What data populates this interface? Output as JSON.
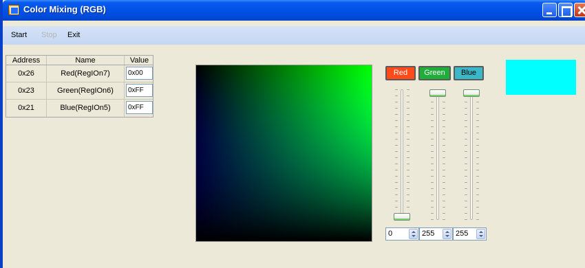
{
  "window": {
    "title": "Color Mixing (RGB)"
  },
  "menu": {
    "items": [
      {
        "label": "Start",
        "enabled": true
      },
      {
        "label": "Stop",
        "enabled": false
      },
      {
        "label": "Exit",
        "enabled": true
      }
    ]
  },
  "table": {
    "headers": [
      "Address",
      "Name",
      "Value"
    ],
    "rows": [
      {
        "address": "0x26",
        "name": "Red(RegIOn7)",
        "value": "0x00"
      },
      {
        "address": "0x23",
        "name": "Green(RegIOn6)",
        "value": "0xFF"
      },
      {
        "address": "0x21",
        "name": "Blue(RegIOn5)",
        "value": "0xFF"
      }
    ]
  },
  "channels": {
    "red": {
      "label": "Red",
      "color": "#ff4a1a",
      "text_color": "#ffffff",
      "value": "0",
      "level": 0
    },
    "green": {
      "label": "Green",
      "color": "#1fae3a",
      "text_color": "#ffffff",
      "value": "255",
      "level": 1
    },
    "blue": {
      "label": "Blue",
      "color": "#3ab8c8",
      "text_color": "#000000",
      "value": "255",
      "level": 1
    }
  },
  "preview": {
    "color": "#00ffff"
  },
  "colors": {
    "titlebar": "#0052e6",
    "window_bg": "#ece9d8"
  }
}
